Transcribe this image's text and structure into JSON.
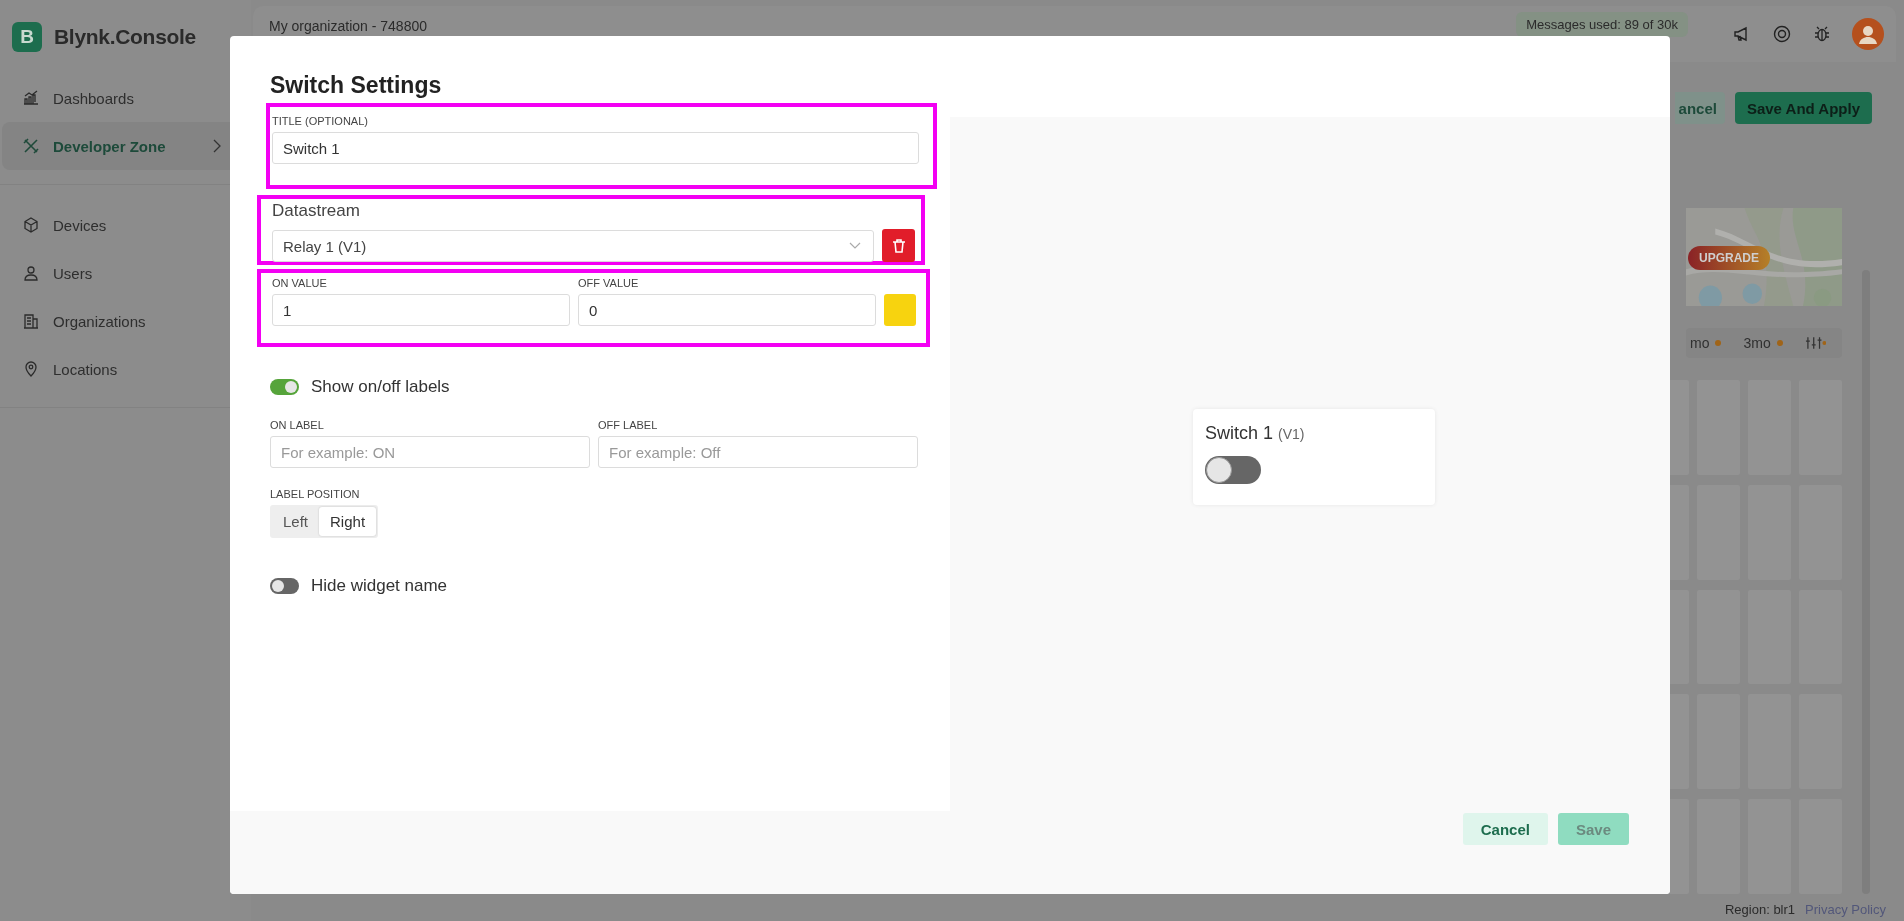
{
  "app": {
    "logo": "B",
    "brand": "Blynk.Console",
    "sidebar": {
      "top": [
        {
          "label": "Dashboards",
          "selected": false,
          "submenu": false
        },
        {
          "label": "Developer Zone",
          "selected": true,
          "submenu": true
        }
      ],
      "main": [
        {
          "label": "Devices",
          "selected": false,
          "submenu": false
        },
        {
          "label": "Users",
          "selected": false,
          "submenu": false
        },
        {
          "label": "Organizations",
          "selected": false,
          "submenu": false
        },
        {
          "label": "Locations",
          "selected": false,
          "submenu": false
        }
      ]
    },
    "org": "My organization - 748800",
    "messages": "Messages used: 89 of 30k",
    "actions": [
      {
        "label": "ancel",
        "kind": "secondary"
      },
      {
        "label": "Save And Apply",
        "kind": "primary"
      }
    ],
    "badge": "UPGRADE",
    "periods": [
      "mo",
      "3mo"
    ],
    "region": "Region: blr1",
    "privacy": "Privacy Policy"
  },
  "modal": {
    "title": "Switch Settings",
    "title_field": {
      "label": "TITLE (OPTIONAL)",
      "value": "Switch 1"
    },
    "datastream": {
      "heading": "Datastream",
      "value": "Relay 1 (V1)"
    },
    "values": {
      "on": {
        "label": "ON VALUE",
        "value": "1"
      },
      "off": {
        "label": "OFF VALUE",
        "value": "0"
      },
      "color": "#f7d30f"
    },
    "show_labels": {
      "label": "Show on/off labels",
      "on": true
    },
    "on_label": {
      "label": "ON LABEL",
      "placeholder": "For example: ON"
    },
    "off_label": {
      "label": "OFF LABEL",
      "placeholder": "For example: Off"
    },
    "label_position": {
      "label": "LABEL POSITION",
      "options": [
        {
          "label": "Left",
          "selected": false
        },
        {
          "label": "Right",
          "selected": true
        }
      ]
    },
    "hide_name": {
      "label": "Hide widget name",
      "on": false
    },
    "preview": {
      "title": "Switch 1",
      "pin": "(V1)",
      "on": false
    },
    "buttons": [
      {
        "label": "Cancel",
        "kind": "secondary",
        "disabled": false
      },
      {
        "label": "Save",
        "kind": "primary",
        "disabled": true
      }
    ]
  }
}
